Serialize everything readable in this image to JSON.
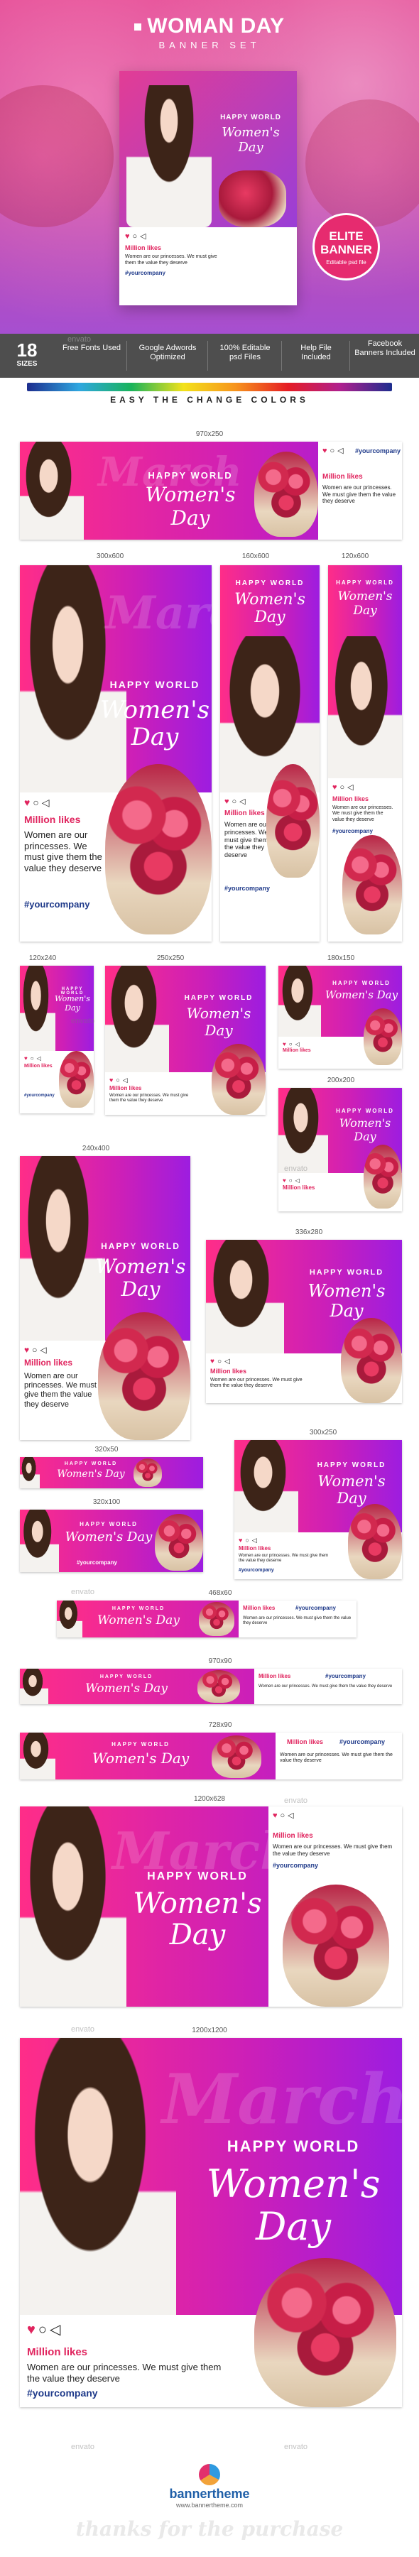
{
  "header": {
    "title": "WOMAN DAY",
    "subtitle": "BANNER SET",
    "badge_line1": "ELITE",
    "badge_line2": "BANNER",
    "badge_small": "Editable psd file"
  },
  "watermark": "envato",
  "features": {
    "count": "18",
    "count_label": "SIZES",
    "items": [
      "Free Fonts Used",
      "Google Adwords Optimized",
      "100% Editable psd Files",
      "Help File Included",
      "Facebook Banners Included"
    ]
  },
  "colors_label": "EASY THE CHANGE COLORS",
  "banner_text": {
    "headline": "HAPPY WORLD",
    "script": "Women's Day",
    "bg_word": "March",
    "likes": "Million likes",
    "body": "Women are our princesses. We must give them the value they deserve",
    "tag": "#yourcompany"
  },
  "sizes": {
    "s970x250": "970x250",
    "s300x600": "300x600",
    "s160x600": "160x600",
    "s120x600": "120x600",
    "s120x240": "120x240",
    "s250x250": "250x250",
    "s180x150": "180x150",
    "s200x200": "200x200",
    "s240x400": "240x400",
    "s336x280": "336x280",
    "s320x50": "320x50",
    "s300x250": "300x250",
    "s320x100": "320x100",
    "s468x60": "468x60",
    "s970x90": "970x90",
    "s728x90": "728x90",
    "s1200x628": "1200x628",
    "s1200x1200": "1200x1200"
  },
  "footer": {
    "brand": "bannertheme",
    "url": "www.bannertheme.com",
    "thanks": "thanks for the purchase"
  },
  "colors": {
    "pink": "#ff2d88",
    "purple": "#9d1de0",
    "feature_bar": "#4e4e4e",
    "tag_blue": "#1f3a8a",
    "heart": "#e0245e"
  }
}
